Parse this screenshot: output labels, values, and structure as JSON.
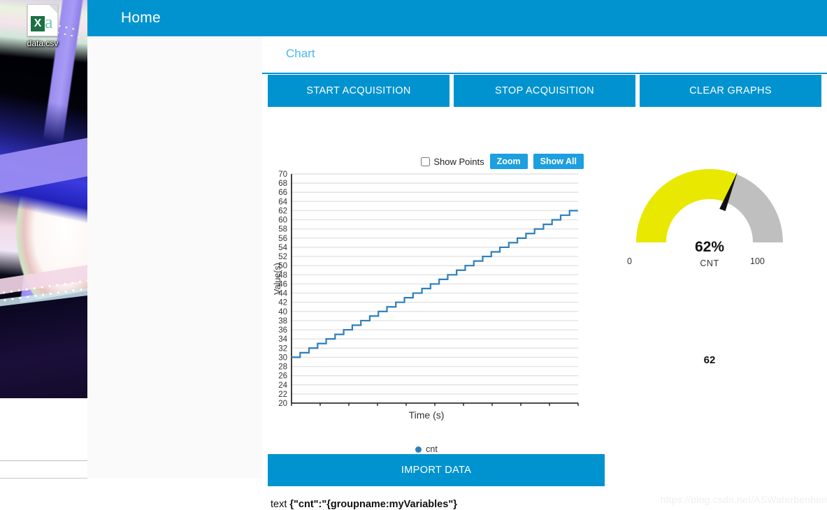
{
  "desktop": {
    "file_icon": {
      "name": "data.csv",
      "badge": "X",
      "glyph": "a"
    }
  },
  "app": {
    "topbar": {
      "title": "Home"
    },
    "tabs": [
      {
        "label": "Chart",
        "active": true
      }
    ],
    "actions": [
      {
        "label": "START ACQUISITION",
        "name": "start-acquisition-button"
      },
      {
        "label": "STOP ACQUISITION",
        "name": "stop-acquisition-button"
      },
      {
        "label": "CLEAR GRAPHS",
        "name": "clear-graphs-button"
      }
    ],
    "chart_controls": {
      "show_points_label": "Show Points",
      "show_points_checked": false,
      "zoom_label": "Zoom",
      "show_all_label": "Show All"
    },
    "import_button": {
      "label": "IMPORT DATA"
    },
    "status": {
      "prefix": "text ",
      "payload": "{\"cnt\":\"{groupname:myVariables\"}"
    },
    "gauge": {
      "percent_label": "62%",
      "name": "CNT",
      "min_label": "0",
      "max_label": "100",
      "value": 62,
      "min": 0,
      "max": 100,
      "fill_color": "#e8e800",
      "track_color": "#bfbfbf",
      "needle_color": "#111111"
    },
    "value_readout": "62",
    "watermark": "https://blog.csdn.net/ASWaterbenben",
    "colors": {
      "accent": "#0093cf",
      "tab_text": "#4ab8ef",
      "series": "#2d7fbc"
    }
  },
  "chart_data": {
    "type": "line",
    "title": "",
    "xlabel": "Time (s)",
    "ylabel": "Value(s)",
    "xlim": [
      0,
      10
    ],
    "ylim": [
      20,
      70
    ],
    "xticks": [
      0,
      1,
      2,
      3,
      4,
      5,
      6,
      7,
      8,
      9,
      10
    ],
    "yticks": [
      20,
      22,
      24,
      26,
      28,
      30,
      32,
      34,
      36,
      38,
      40,
      42,
      44,
      46,
      48,
      50,
      52,
      54,
      56,
      58,
      60,
      62,
      64,
      66,
      68,
      70
    ],
    "grid": true,
    "legend": [
      "cnt"
    ],
    "legend_position": "bottom-center",
    "step": "post",
    "series": [
      {
        "name": "cnt",
        "color": "#2d7fbc",
        "x": [
          0,
          0.3,
          0.61,
          0.91,
          1.21,
          1.52,
          1.82,
          2.12,
          2.42,
          2.73,
          3.03,
          3.33,
          3.64,
          3.94,
          4.24,
          4.55,
          4.85,
          5.15,
          5.45,
          5.76,
          6.06,
          6.36,
          6.67,
          6.97,
          7.27,
          7.58,
          7.88,
          8.18,
          8.48,
          8.79,
          9.09,
          9.39,
          9.7
        ],
        "y": [
          30,
          31,
          32,
          33,
          34,
          35,
          36,
          37,
          38,
          39,
          40,
          41,
          42,
          43,
          44,
          45,
          46,
          47,
          48,
          49,
          50,
          51,
          52,
          53,
          54,
          55,
          56,
          57,
          58,
          59,
          60,
          61,
          62
        ]
      }
    ]
  }
}
